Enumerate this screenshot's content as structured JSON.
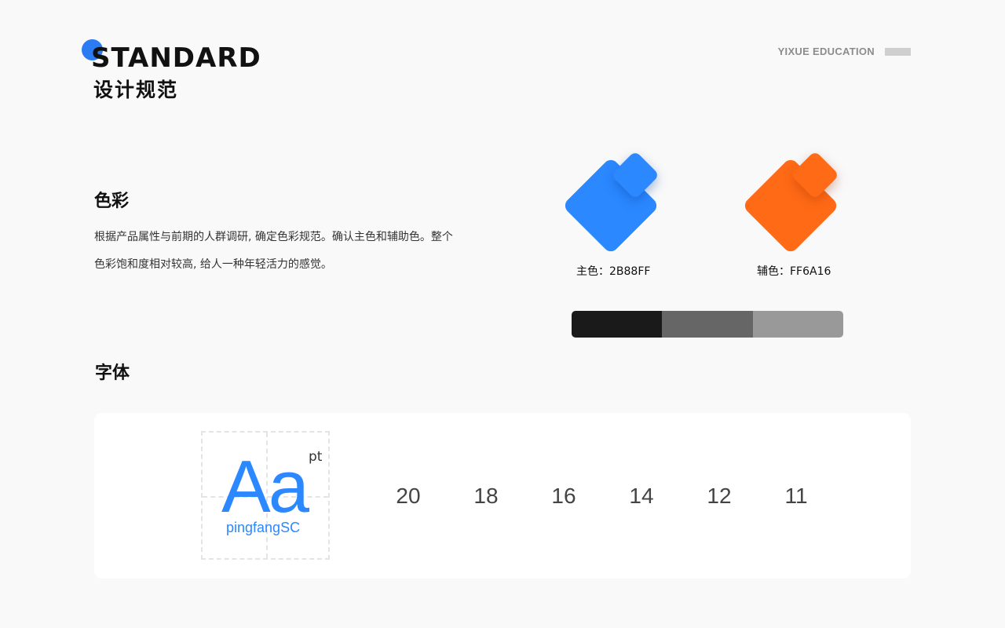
{
  "header": {
    "title": "STANDARD",
    "subtitle": "设计规范",
    "brand": "YIXUE EDUCATION"
  },
  "color_section": {
    "title": "色彩",
    "description": "根据产品属性与前期的人群调研, 确定色彩规范。确认主色和辅助色。整个色彩饱和度相对较高, 给人一种年轻活力的感觉。",
    "primary": {
      "label": "主色：2B88FF",
      "color": "#2b88ff"
    },
    "secondary": {
      "label": "辅色：FF6A16",
      "color": "#ff6a16"
    },
    "grays": [
      "#1a1a1a",
      "#666666",
      "#999999"
    ]
  },
  "font_section": {
    "title": "字体",
    "sample": "Aa",
    "unit": "pt",
    "font_name": "pingfangSC",
    "sizes": [
      "20",
      "18",
      "16",
      "14",
      "12",
      "11"
    ]
  }
}
